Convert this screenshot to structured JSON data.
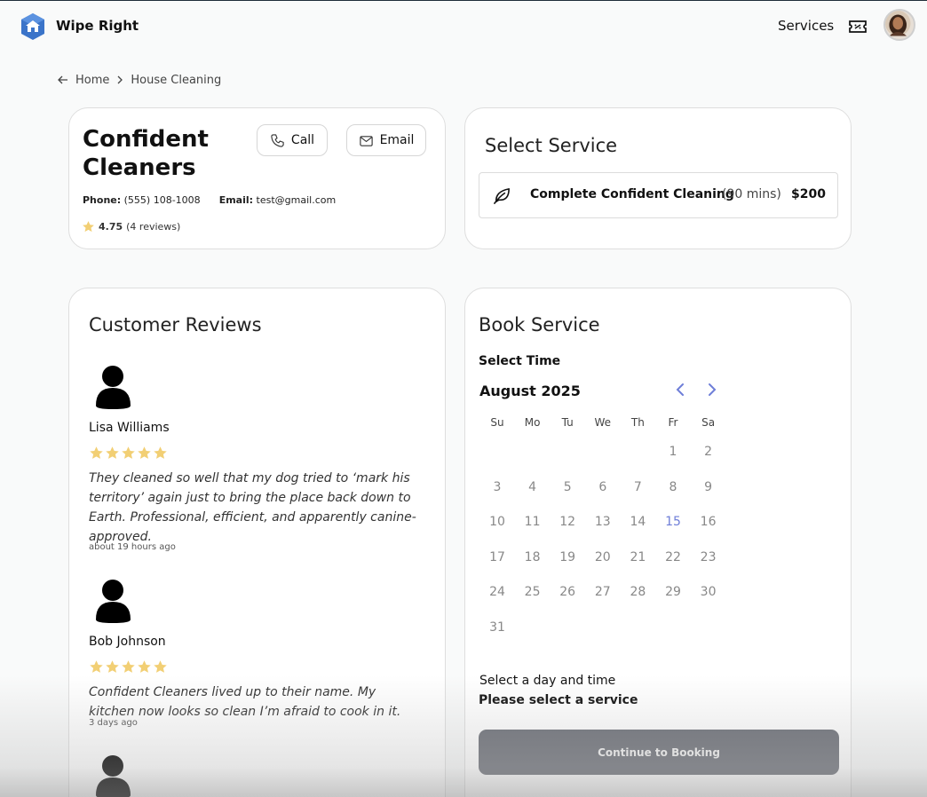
{
  "header": {
    "brand": "Wipe Right",
    "nav_services": "Services"
  },
  "breadcrumb": {
    "home": "Home",
    "current": "House Cleaning"
  },
  "company": {
    "name": "Confident Cleaners",
    "call_label": "Call",
    "email_label": "Email",
    "phone_label": "Phone:",
    "phone": "(555) 108-1008",
    "email_field_label": "Email:",
    "email": "test@gmail.com",
    "rating": "4.75",
    "reviews_count": "(4 reviews)"
  },
  "select_service": {
    "title": "Select Service",
    "items": [
      {
        "name": "Complete Confident Cleaning",
        "duration": "(90 mins)",
        "price": "$200"
      }
    ]
  },
  "reviews": {
    "title": "Customer Reviews",
    "items": [
      {
        "name": "Lisa Williams",
        "stars": 5,
        "text": "They cleaned so well that my dog tried to ‘mark his territory’ again just to bring the place back down to Earth. Professional, efficient, and apparently canine-approved.",
        "time": "about 19 hours ago"
      },
      {
        "name": "Bob Johnson",
        "stars": 5,
        "text": "Confident Cleaners lived up to their name. My kitchen now looks so clean I’m afraid to cook in it.",
        "time": "3 days ago"
      }
    ]
  },
  "booking": {
    "title": "Book Service",
    "select_time": "Select Time",
    "month": "August 2025",
    "weekdays": [
      "Su",
      "Mo",
      "Tu",
      "We",
      "Th",
      "Fr",
      "Sa"
    ],
    "first_weekday_index": 5,
    "days_in_month": 31,
    "highlighted_day": 15,
    "hint": "Select a day and time",
    "hint_bold": "Please select a service",
    "continue_label": "Continue to Booking"
  },
  "colors": {
    "accent": "#6e7ed8",
    "star": "#f2cf74",
    "button_disabled": "#6b6e76",
    "logo": "#3b74c9"
  }
}
